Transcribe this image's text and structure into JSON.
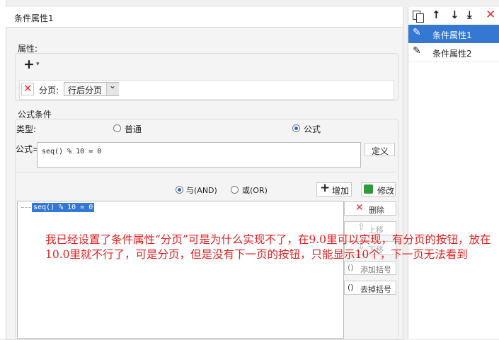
{
  "window": {
    "title": "条件属性1"
  },
  "properties": {
    "group_label": "属性:",
    "add_symbol": "+",
    "dropdown_arrow": "▾",
    "delete_symbol": "✕",
    "row_label": "分页:",
    "select_value": "行后分页",
    "select_arrow": "⌄"
  },
  "formula_condition": {
    "group_label": "公式条件",
    "type_label": "类型:",
    "option_normal": "普通",
    "option_formula": "公式",
    "selected": "公式",
    "formula_label": "公式=",
    "formula_value": "seq() % 10 = 0",
    "define_button": "定义",
    "and_label": "与(AND)",
    "or_label": "或(OR)",
    "logic_selected": "与(AND)",
    "add_button": "增加",
    "edit_button": "修改",
    "condition_list": [
      "seq() % 10 = 0"
    ],
    "delete_button": "删除",
    "up_button": "上移",
    "down_button": "下移",
    "add_bracket_button": "添加括号",
    "remove_bracket_button": "去掉括号"
  },
  "right_panel": {
    "toolbar": {
      "copy_icon": "copy-icon",
      "up_icon": "arrow-up-icon",
      "down_icon": "arrow-down-icon",
      "bottom_icon": "move-bottom-icon",
      "delete_icon": "delete-icon"
    },
    "items": [
      {
        "label": "条件属性1",
        "selected": true
      },
      {
        "label": "条件属性2",
        "selected": false
      }
    ]
  },
  "overlay_comment": "我已经设置了条件属性“分页”可是为什么实现不了，在9.0里可以实现，有分页的按钮，放在10.0里就不行了，可是分页，但是没有下一页的按钮，只能显示10个，下一页无法看到",
  "colors": {
    "selection": "#3478d4",
    "accent": "#e02020",
    "red_x": "#e03030"
  }
}
